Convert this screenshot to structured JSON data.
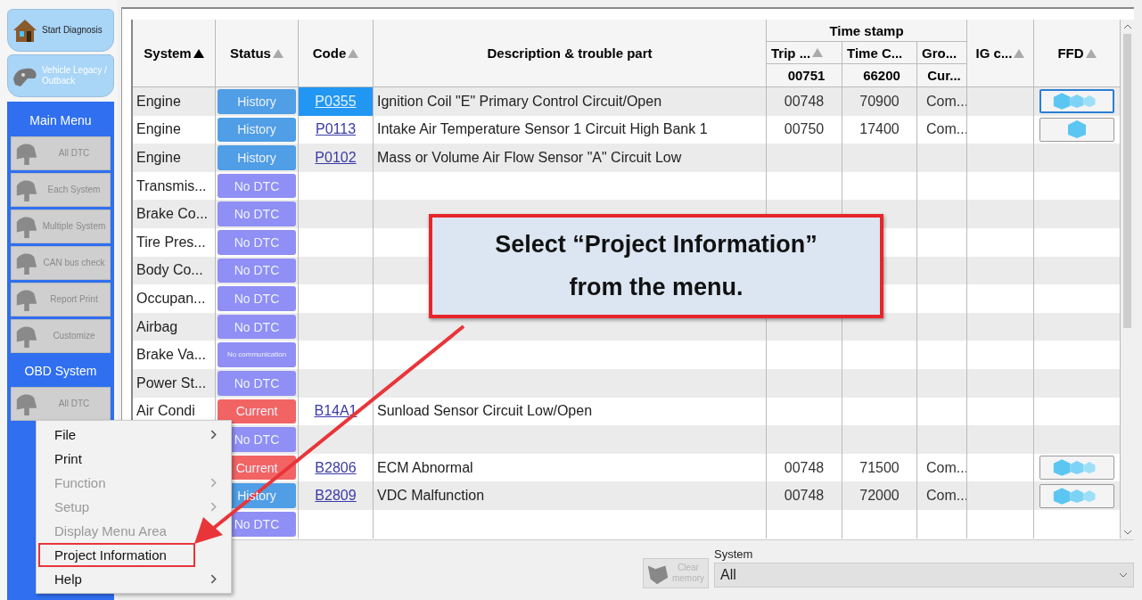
{
  "sidebar": {
    "nav": [
      {
        "label": "Start Diagnosis",
        "kind": "house"
      },
      {
        "label": "Vehicle Legacy / Outback",
        "kind": "car"
      }
    ],
    "sections": [
      {
        "title": "Main Menu",
        "buttons": [
          {
            "label": "All DTC",
            "disabled": true
          },
          {
            "label": "Each System",
            "disabled": true
          },
          {
            "label": "Multiple System",
            "disabled": true
          },
          {
            "label": "CAN bus check",
            "disabled": true
          },
          {
            "label": "Report Print",
            "disabled": true
          },
          {
            "label": "Customize",
            "disabled": true
          }
        ]
      },
      {
        "title": "OBD System",
        "buttons": [
          {
            "label": "All DTC",
            "disabled": true
          }
        ]
      }
    ]
  },
  "table": {
    "columns": [
      {
        "label": "System",
        "sorted": true
      },
      {
        "label": "Status",
        "sorted": false
      },
      {
        "label": "Code",
        "sorted": false
      },
      {
        "label": "Description & trouble part"
      }
    ],
    "group": {
      "label": "Time stamp",
      "columns": [
        {
          "label": "Trip ...",
          "sorted": false,
          "value": "00751"
        },
        {
          "label": "Time C...",
          "value": "66200"
        },
        {
          "label": "Gro...",
          "value": "Cur..."
        }
      ]
    },
    "trailing_columns": [
      {
        "label": "IG c...",
        "sorted": false
      },
      {
        "label": "FFD",
        "sorted": false
      }
    ],
    "rows": [
      {
        "system": "Engine",
        "status": {
          "label": "History",
          "kind": "history"
        },
        "code": "P0355",
        "code_selected": true,
        "description": "Ignition Coil \"E\" Primary Control Circuit/Open",
        "trip": "00748",
        "time": "70900",
        "group": "Com...",
        "ffd": {
          "kind": "triple",
          "selected": true
        }
      },
      {
        "system": "Engine",
        "status": {
          "label": "History",
          "kind": "history"
        },
        "code": "P0113",
        "code_selected": false,
        "description": "Intake Air Temperature Sensor 1 Circuit High Bank 1",
        "trip": "00750",
        "time": "17400",
        "group": "Com...",
        "ffd": {
          "kind": "single",
          "selected": false
        }
      },
      {
        "system": "Engine",
        "status": {
          "label": "History",
          "kind": "history"
        },
        "code": "P0102",
        "code_selected": false,
        "description": "Mass or Volume Air Flow Sensor \"A\" Circuit Low"
      },
      {
        "system": "Transmis...",
        "status": {
          "label": "No DTC",
          "kind": "none"
        }
      },
      {
        "system": "Brake Co...",
        "status": {
          "label": "No DTC",
          "kind": "none"
        }
      },
      {
        "system": "Tire Pres...",
        "status": {
          "label": "No DTC",
          "kind": "none"
        }
      },
      {
        "system": "Body Co...",
        "status": {
          "label": "No DTC",
          "kind": "none"
        }
      },
      {
        "system": "Occupan...",
        "status": {
          "label": "No DTC",
          "kind": "none"
        }
      },
      {
        "system": "Airbag",
        "status": {
          "label": "No DTC",
          "kind": "none"
        }
      },
      {
        "system": "Brake Va...",
        "status": {
          "label": "No communication",
          "kind": "nocomm"
        }
      },
      {
        "system": "Power St...",
        "status": {
          "label": "No DTC",
          "kind": "none"
        }
      },
      {
        "system": "Air Condi",
        "status": {
          "label": "Current",
          "kind": "current"
        },
        "code": "B14A1",
        "code_selected": false,
        "description": "Sunload Sensor Circuit Low/Open"
      },
      {
        "status": {
          "label": "No DTC",
          "kind": "none"
        }
      },
      {
        "status": {
          "label": "Current",
          "kind": "current"
        },
        "code": "B2806",
        "code_selected": false,
        "description": "ECM Abnormal",
        "trip": "00748",
        "time": "71500",
        "group": "Com...",
        "ffd": {
          "kind": "triple",
          "selected": false
        }
      },
      {
        "status": {
          "label": "History",
          "kind": "history"
        },
        "code": "B2809",
        "code_selected": false,
        "description": "VDC Malfunction",
        "trip": "00748",
        "time": "72000",
        "group": "Com...",
        "ffd": {
          "kind": "triple",
          "selected": false
        }
      },
      {
        "status": {
          "label": "No DTC",
          "kind": "none"
        }
      }
    ]
  },
  "bottom_bar": {
    "clear_button": {
      "label": "Clear memory",
      "disabled": true
    },
    "system_label": "System",
    "system_value": "All"
  },
  "context_menu": {
    "items": [
      {
        "label": "File",
        "disabled": false,
        "submenu": true,
        "highlighted": false
      },
      {
        "label": "Print",
        "disabled": false,
        "submenu": false,
        "highlighted": false
      },
      {
        "label": "Function",
        "disabled": true,
        "submenu": true,
        "highlighted": false
      },
      {
        "label": "Setup",
        "disabled": true,
        "submenu": true,
        "highlighted": false
      },
      {
        "label": "Display Menu Area",
        "disabled": true,
        "submenu": false,
        "highlighted": false
      },
      {
        "label": "Project Information",
        "disabled": false,
        "submenu": false,
        "highlighted": true
      },
      {
        "label": "Help",
        "disabled": false,
        "submenu": true,
        "highlighted": false
      }
    ]
  },
  "callout": {
    "text": "Select “Project Information” from the menu."
  }
}
